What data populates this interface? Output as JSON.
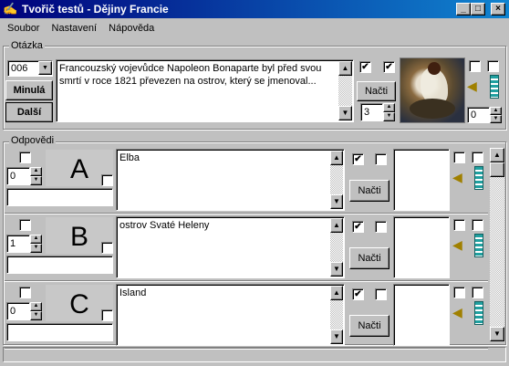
{
  "window": {
    "title": "Tvořič testů - Dějiny Francie"
  },
  "menu": [
    "Soubor",
    "Nastavení",
    "Nápověda"
  ],
  "question": {
    "group_label": "Otázka",
    "number": "006",
    "text": "Francouzský vojevůdce Napoleon Bonaparte byl před svou smrtí v roce 1821 převezen na ostrov, který se jmenoval...",
    "prev_label": "Minulá",
    "next_label": "Další",
    "load_label": "Načti",
    "count": "3",
    "sound_value": "0",
    "checkbox_states": [
      true,
      true,
      false,
      false
    ]
  },
  "answers": {
    "group_label": "Odpovědi",
    "items": [
      {
        "letter": "A",
        "text": "Elba",
        "points": "0",
        "load_label": "Načti",
        "correct": true
      },
      {
        "letter": "B",
        "text": "ostrov Svaté Heleny",
        "points": "1",
        "load_label": "Načti",
        "correct": true
      },
      {
        "letter": "C",
        "text": "Island",
        "points": "0",
        "load_label": "Načti",
        "correct": true
      }
    ]
  },
  "icons": [
    "app-icon",
    "minimize-icon",
    "maximize-icon",
    "close-icon",
    "speaker-icon",
    "film-icon",
    "scroll-up-icon",
    "scroll-down-icon",
    "dropdown-arrow-icon"
  ],
  "colors": {
    "title_bar": "#00007b",
    "face": "#c0c0c0"
  }
}
